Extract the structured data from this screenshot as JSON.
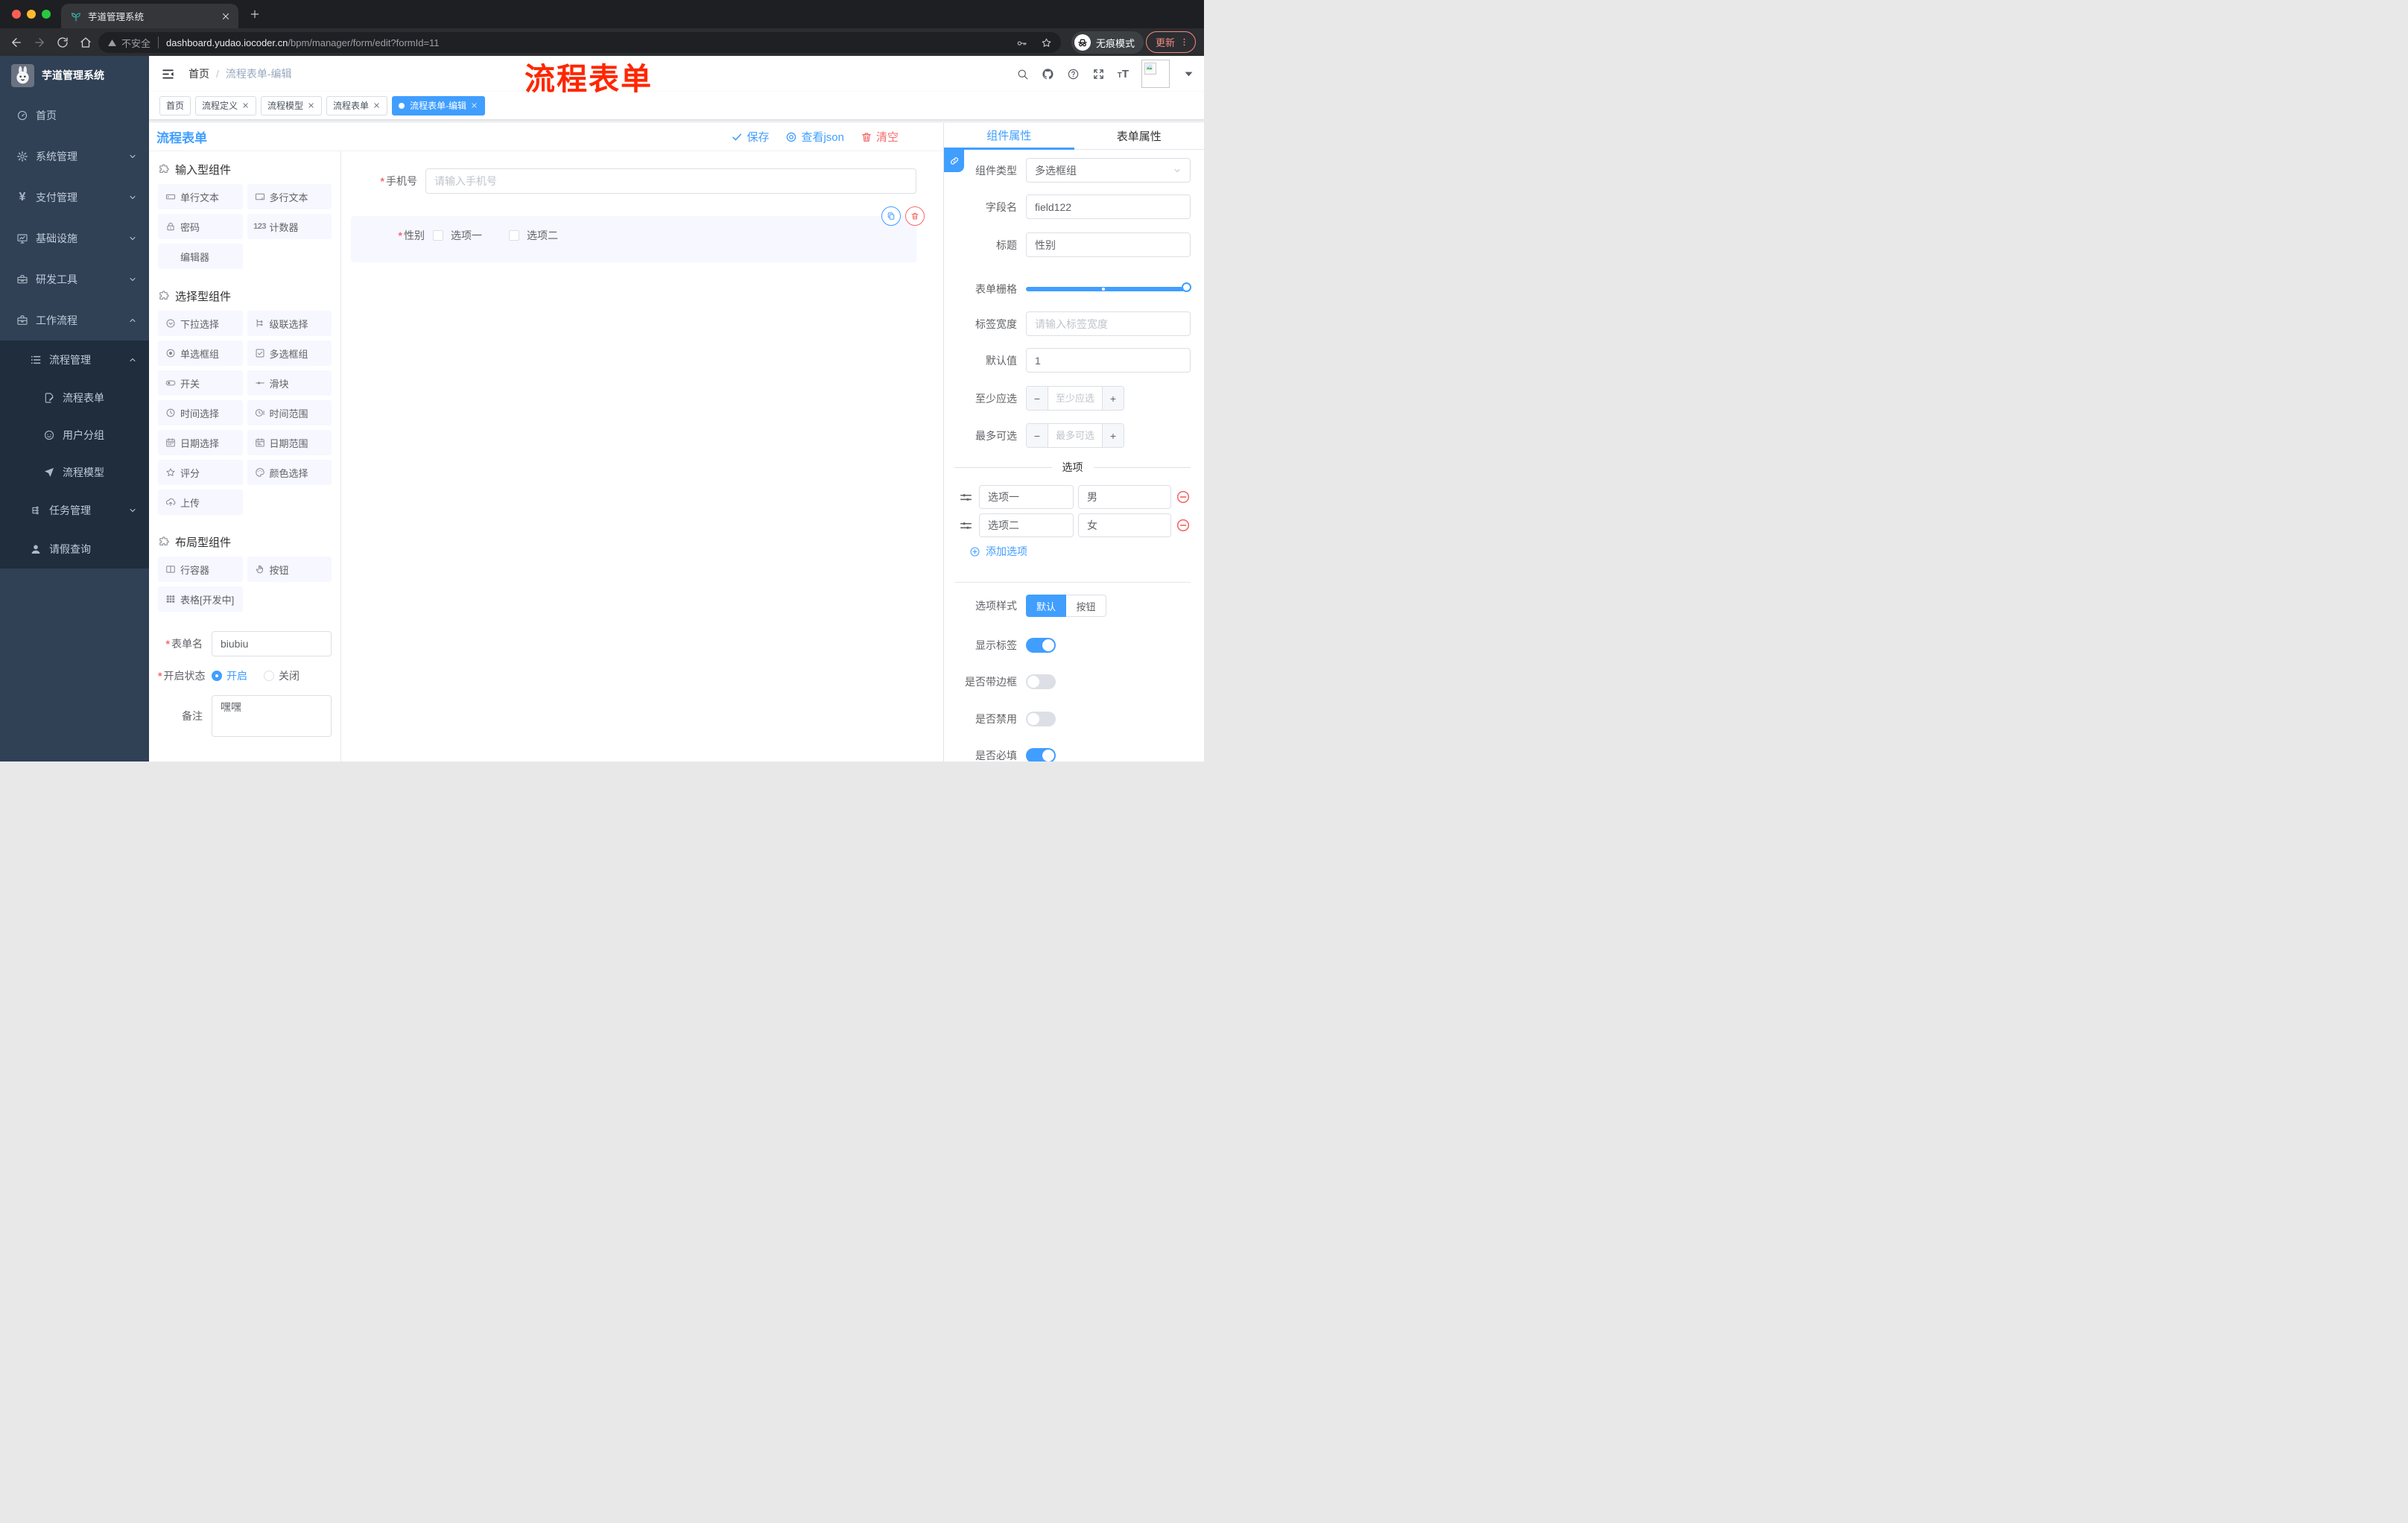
{
  "colors": {
    "accent": "#409eff",
    "danger": "#f56c6c",
    "annotation": "#ff2600",
    "sidebar_bg": "#304156",
    "submenu_bg": "#1f2d3d"
  },
  "browser": {
    "tab_title": "芋道管理系统",
    "insecure_label": "不安全",
    "url_host": "dashboard.yudao.iocoder.cn",
    "url_path": "/bpm/manager/form/edit?formId=11",
    "incognito_label": "无痕模式",
    "update_label": "更新"
  },
  "annotation": {
    "text": "流程表单"
  },
  "sidebar": {
    "brand": "芋道管理系统",
    "items": [
      {
        "label": "首页",
        "icon": "dashboard"
      },
      {
        "label": "系统管理",
        "icon": "gear",
        "chevron": "down"
      },
      {
        "label": "支付管理",
        "icon": "yen",
        "chevron": "down"
      },
      {
        "label": "基础设施",
        "icon": "monitor",
        "chevron": "down"
      },
      {
        "label": "研发工具",
        "icon": "toolbox",
        "chevron": "down"
      },
      {
        "label": "工作流程",
        "icon": "briefcase",
        "chevron": "up"
      }
    ],
    "submenu": [
      {
        "label": "流程管理",
        "icon": "listmenu",
        "chevron": "up",
        "indent": 1
      },
      {
        "label": "流程表单",
        "icon": "docedit",
        "indent": 2
      },
      {
        "label": "用户分组",
        "icon": "face",
        "indent": 2
      },
      {
        "label": "流程模型",
        "icon": "send",
        "indent": 2
      },
      {
        "label": "任务管理",
        "icon": "tree",
        "chevron": "down",
        "indent": 1
      },
      {
        "label": "请假查询",
        "icon": "user",
        "indent": 1
      }
    ]
  },
  "header": {
    "crumb_home": "首页",
    "crumb_sep": "/",
    "crumb_current": "流程表单-编辑"
  },
  "tags": [
    {
      "label": "首页",
      "closable": false,
      "active": false
    },
    {
      "label": "流程定义",
      "closable": true,
      "active": false
    },
    {
      "label": "流程模型",
      "closable": true,
      "active": false
    },
    {
      "label": "流程表单",
      "closable": true,
      "active": false
    },
    {
      "label": "流程表单-编辑",
      "closable": true,
      "active": true
    }
  ],
  "card": {
    "title": "流程表单",
    "save_label": "保存",
    "view_label": "查看json",
    "clear_label": "清空"
  },
  "palette": {
    "groups": [
      {
        "title": "输入型组件",
        "items": [
          {
            "label": "单行文本",
            "icon": "tinput"
          },
          {
            "label": "多行文本",
            "icon": "tarea"
          },
          {
            "label": "密码",
            "icon": "lock"
          },
          {
            "label": "计数器",
            "icon": "counter"
          },
          {
            "label": "编辑器",
            "icon": "none"
          }
        ]
      },
      {
        "title": "选择型组件",
        "items": [
          {
            "label": "下拉选择",
            "icon": "select"
          },
          {
            "label": "级联选择",
            "icon": "cascade"
          },
          {
            "label": "单选框组",
            "icon": "radio"
          },
          {
            "label": "多选框组",
            "icon": "checkbox"
          },
          {
            "label": "开关",
            "icon": "switch"
          },
          {
            "label": "滑块",
            "icon": "slideric"
          },
          {
            "label": "时间选择",
            "icon": "time"
          },
          {
            "label": "时间范围",
            "icon": "timerange"
          },
          {
            "label": "日期选择",
            "icon": "date"
          },
          {
            "label": "日期范围",
            "icon": "daterange"
          },
          {
            "label": "评分",
            "icon": "star"
          },
          {
            "label": "颜色选择",
            "icon": "palette"
          },
          {
            "label": "上传",
            "icon": "upload"
          }
        ]
      },
      {
        "title": "布局型组件",
        "items": [
          {
            "label": "行容器",
            "icon": "rowic"
          },
          {
            "label": "按钮",
            "icon": "hand"
          },
          {
            "label": "表格[开发中]",
            "icon": "tablegrid"
          }
        ]
      }
    ],
    "form": {
      "name_label": "表单名",
      "name_value": "biubiu",
      "status_label": "开启状态",
      "status_on": "开启",
      "status_off": "关闭",
      "remark_label": "备注",
      "remark_value": "嘿嘿"
    }
  },
  "canvas": {
    "phone": {
      "label": "手机号",
      "placeholder": "请输入手机号"
    },
    "gender": {
      "label": "性别",
      "option1": "选项一",
      "option2": "选项二"
    }
  },
  "panel": {
    "tab_component": "组件属性",
    "tab_form": "表单属性",
    "fields": {
      "type_label": "组件类型",
      "type_value": "多选框组",
      "field_label": "字段名",
      "field_value": "field122",
      "title_label": "标题",
      "title_value": "性别",
      "grid_label": "表单栅格",
      "width_label": "标签宽度",
      "width_placeholder": "请输入标签宽度",
      "default_label": "默认值",
      "default_value": "1",
      "min_label": "至少应选",
      "min_placeholder": "至少应选",
      "max_label": "最多可选",
      "max_placeholder": "最多可选"
    },
    "options": {
      "divider": "选项",
      "rows": [
        {
          "label": "选项一",
          "value": "男"
        },
        {
          "label": "选项二",
          "value": "女"
        }
      ],
      "add_label": "添加选项"
    },
    "style": {
      "label": "选项样式",
      "opt_default": "默认",
      "opt_button": "按钮"
    },
    "switches": [
      {
        "label": "显示标签",
        "on": true
      },
      {
        "label": "是否带边框",
        "on": false
      },
      {
        "label": "是否禁用",
        "on": false
      },
      {
        "label": "是否必填",
        "on": true
      }
    ]
  }
}
